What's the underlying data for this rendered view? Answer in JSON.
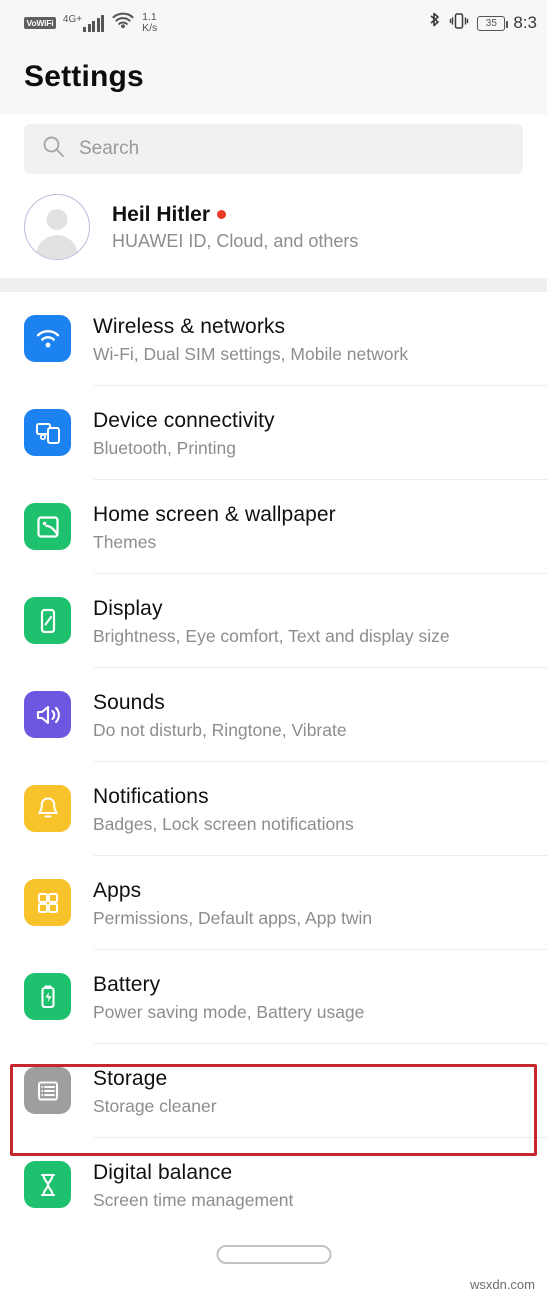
{
  "status_bar": {
    "vowifi_label": "VoWiFi",
    "network_label": "4G+",
    "speed_value": "1.1",
    "speed_unit": "K/s",
    "battery_level": "35",
    "time": "8:3",
    "icons": [
      "vowifi-icon",
      "signal-bars-icon",
      "wifi-icon",
      "bluetooth-icon",
      "vibrate-icon",
      "battery-icon"
    ]
  },
  "header": {
    "title": "Settings"
  },
  "search": {
    "placeholder": "Search",
    "icon": "search-icon"
  },
  "account": {
    "name": "Heil Hitler",
    "subtitle": "HUAWEI ID, Cloud, and others",
    "has_badge_dot": true,
    "badge_color": "#ea3a25",
    "avatar_icon": "person-avatar-icon"
  },
  "settings_list": [
    {
      "title": "Wireless & networks",
      "subtitle": "Wi-Fi, Dual SIM settings, Mobile network",
      "icon": "wifi-icon",
      "icon_color": "#1b82f0"
    },
    {
      "title": "Device connectivity",
      "subtitle": "Bluetooth, Printing",
      "icon": "device-connectivity-icon",
      "icon_color": "#1b82f0"
    },
    {
      "title": "Home screen & wallpaper",
      "subtitle": "Themes",
      "icon": "wallpaper-image-icon",
      "icon_color": "#1ec16e"
    },
    {
      "title": "Display",
      "subtitle": "Brightness, Eye comfort, Text and display size",
      "icon": "display-phone-icon",
      "icon_color": "#1ec16e"
    },
    {
      "title": "Sounds",
      "subtitle": "Do not disturb, Ringtone, Vibrate",
      "icon": "speaker-sound-icon",
      "icon_color": "#6e56e0"
    },
    {
      "title": "Notifications",
      "subtitle": "Badges, Lock screen notifications",
      "icon": "bell-icon",
      "icon_color": "#f8c32a"
    },
    {
      "title": "Apps",
      "subtitle": "Permissions, Default apps, App twin",
      "icon": "apps-grid-icon",
      "icon_color": "#f8c32a"
    },
    {
      "title": "Battery",
      "subtitle": "Power saving mode, Battery usage",
      "icon": "battery-icon",
      "icon_color": "#1ec16e"
    },
    {
      "title": "Storage",
      "subtitle": "Storage cleaner",
      "icon": "storage-list-icon",
      "icon_color": "#9e9e9e",
      "highlighted": true
    },
    {
      "title": "Digital balance",
      "subtitle": "Screen time management",
      "icon": "hourglass-icon",
      "icon_color": "#1ec16e"
    }
  ],
  "highlight": {
    "color": "#c4282d",
    "target": "Storage"
  },
  "watermark": "wsxdn.com"
}
